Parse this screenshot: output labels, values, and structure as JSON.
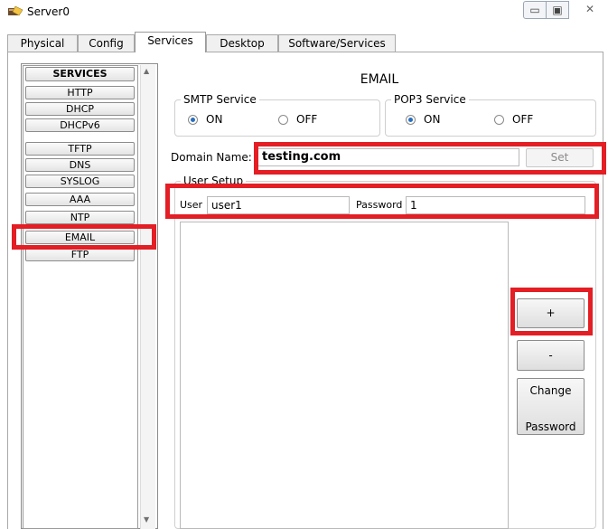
{
  "window": {
    "title": "Server0",
    "controls": {
      "minimize": "▭",
      "maximize": "▣",
      "close": "✕"
    }
  },
  "tabs": [
    {
      "label": "Physical",
      "active": false
    },
    {
      "label": "Config",
      "active": false
    },
    {
      "label": "Services",
      "active": true
    },
    {
      "label": "Desktop",
      "active": false
    },
    {
      "label": "Software/Services",
      "active": false
    }
  ],
  "services": {
    "header": "SERVICES",
    "items": [
      "HTTP",
      "DHCP",
      "DHCPv6",
      "TFTP",
      "DNS",
      "SYSLOG",
      "AAA",
      "NTP",
      "EMAIL",
      "FTP"
    ],
    "selected": "EMAIL"
  },
  "email": {
    "title": "EMAIL",
    "smtp": {
      "legend": "SMTP Service",
      "on_label": "ON",
      "off_label": "OFF",
      "value": "ON"
    },
    "pop3": {
      "legend": "POP3 Service",
      "on_label": "ON",
      "off_label": "OFF",
      "value": "ON"
    },
    "domain": {
      "label": "Domain Name:",
      "value": "testing.com",
      "set_label": "Set"
    },
    "user_setup": {
      "legend": "User Setup",
      "user_label": "User",
      "user_value": "user1",
      "password_label": "Password",
      "password_value": "1",
      "users": []
    },
    "buttons": {
      "add": "+",
      "remove": "-",
      "change_line1": "Change",
      "change_line2": "Password"
    }
  },
  "colors": {
    "highlight": "#e31e24",
    "radio_selected": "#2a6fbd"
  }
}
